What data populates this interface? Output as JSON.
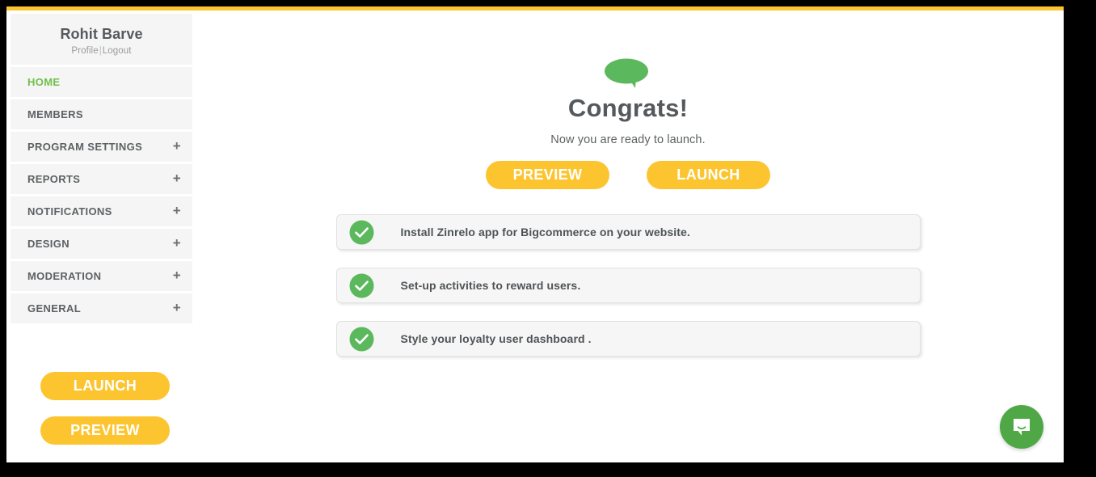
{
  "theme": {
    "accent_yellow": "#fbc531",
    "button_yellow": "#fcc530",
    "green": "#6fbf4a",
    "check_green": "#5cb85c",
    "chat_green": "#4fa845",
    "text_gray": "#55595c",
    "panel_gray": "#f5f5f5"
  },
  "sidebar": {
    "profile": {
      "name": "Rohit Barve",
      "profile_link": "Profile",
      "separator": "|",
      "logout_link": "Logout"
    },
    "items": [
      {
        "label": "HOME",
        "expandable": false,
        "active": true
      },
      {
        "label": "MEMBERS",
        "expandable": false,
        "active": false
      },
      {
        "label": "PROGRAM SETTINGS",
        "expandable": true,
        "active": false
      },
      {
        "label": "REPORTS",
        "expandable": true,
        "active": false
      },
      {
        "label": "NOTIFICATIONS",
        "expandable": true,
        "active": false
      },
      {
        "label": "DESIGN",
        "expandable": true,
        "active": false
      },
      {
        "label": "MODERATION",
        "expandable": true,
        "active": false
      },
      {
        "label": "GENERAL",
        "expandable": true,
        "active": false
      }
    ],
    "expand_icon": "+",
    "buttons": [
      {
        "label": "LAUNCH"
      },
      {
        "label": "PREVIEW"
      }
    ]
  },
  "main": {
    "icon": "speech-bubble-icon",
    "title": "Congrats!",
    "subtitle": "Now you are ready to launch.",
    "actions": [
      {
        "label": "PREVIEW"
      },
      {
        "label": "LAUNCH"
      }
    ],
    "checklist": [
      {
        "label": "Install Zinrelo app for Bigcommerce on your website.",
        "state": "complete"
      },
      {
        "label": "Set-up activities to reward users.",
        "state": "complete"
      },
      {
        "label": "Style your loyalty user dashboard .",
        "state": "complete"
      }
    ]
  },
  "chat": {
    "icon": "chat-bubble-icon",
    "label": "Open chat"
  }
}
